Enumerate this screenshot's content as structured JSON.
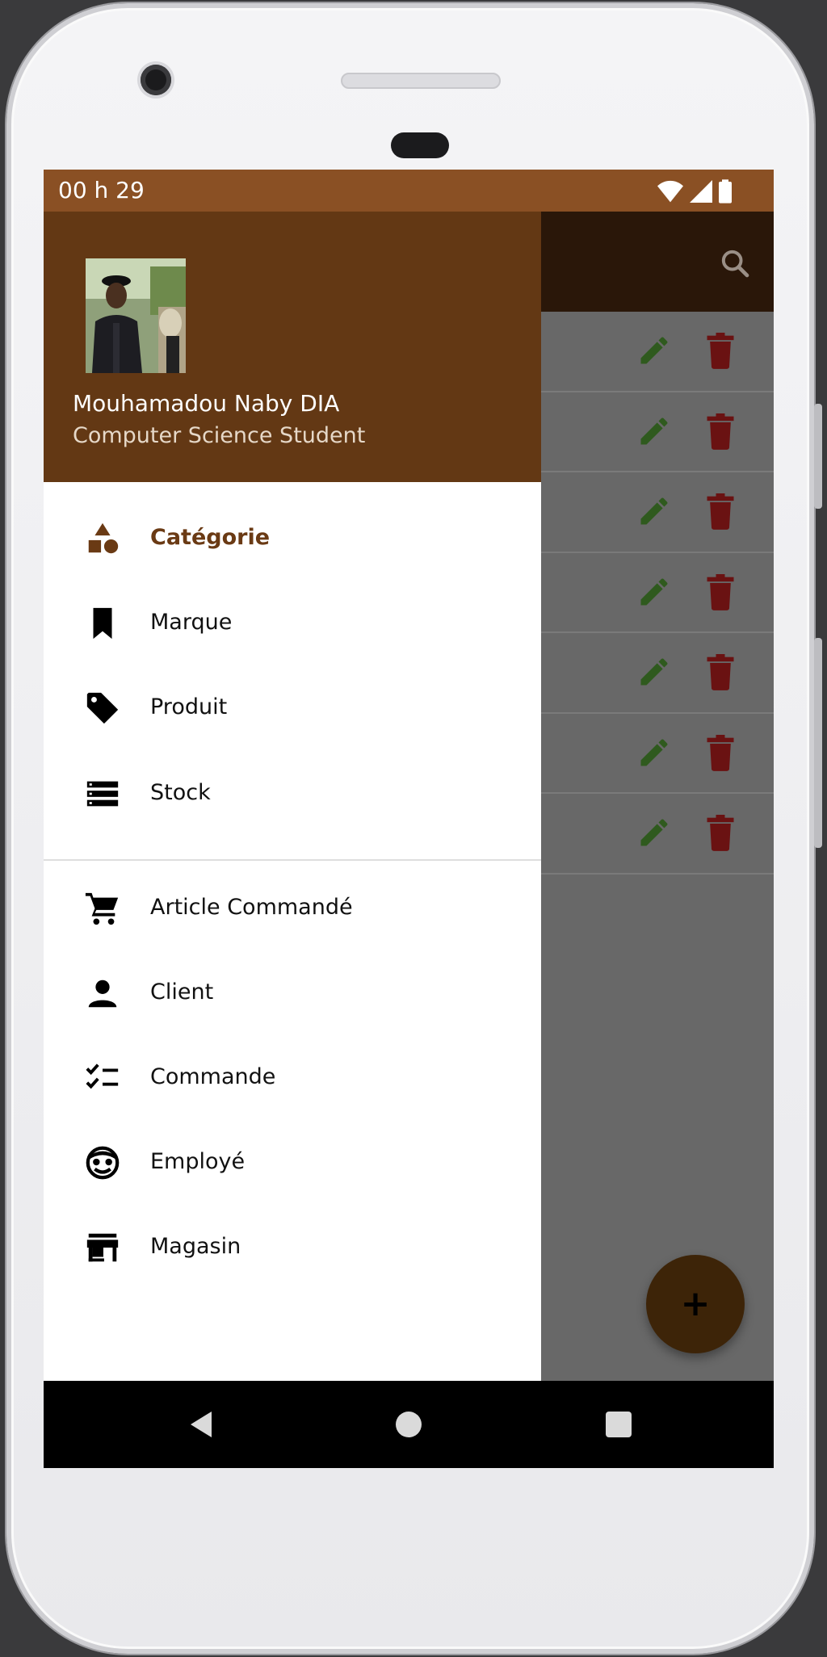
{
  "status_bar": {
    "time": "00 h 29",
    "icons": [
      "wifi-icon",
      "signal-icon",
      "battery-icon"
    ]
  },
  "app_bar": {
    "search_icon": "search-icon"
  },
  "list": {
    "row_count": 7,
    "actions": [
      "edit-icon",
      "delete-icon"
    ]
  },
  "fab": {
    "label": "+"
  },
  "drawer": {
    "header": {
      "name": "Mouhamadou Naby DIA",
      "subtitle": "Computer Science Student"
    },
    "items": [
      {
        "label": "Catégorie",
        "icon": "category-icon",
        "active": true
      },
      {
        "label": "Marque",
        "icon": "bookmark-icon",
        "active": false
      },
      {
        "label": "Produit",
        "icon": "tag-icon",
        "active": false
      },
      {
        "label": "Stock",
        "icon": "storage-icon",
        "active": false
      },
      {
        "label": "Article Commandé",
        "icon": "cart-icon",
        "active": false
      },
      {
        "label": "Client",
        "icon": "person-icon",
        "active": false
      },
      {
        "label": "Commande",
        "icon": "checklist-icon",
        "active": false
      },
      {
        "label": "Employé",
        "icon": "face-icon",
        "active": false
      },
      {
        "label": "Magasin",
        "icon": "store-icon",
        "active": false
      }
    ]
  },
  "colors": {
    "status_bar": "#8a5024",
    "header": "#633814",
    "app_bar": "#2a1709",
    "accent": "#6a3a14",
    "edit": "#2f5a1e",
    "delete": "#6a1212",
    "fab": "#3d2408"
  },
  "nav_bar": {
    "buttons": [
      "back-icon",
      "home-icon",
      "recents-icon"
    ]
  }
}
